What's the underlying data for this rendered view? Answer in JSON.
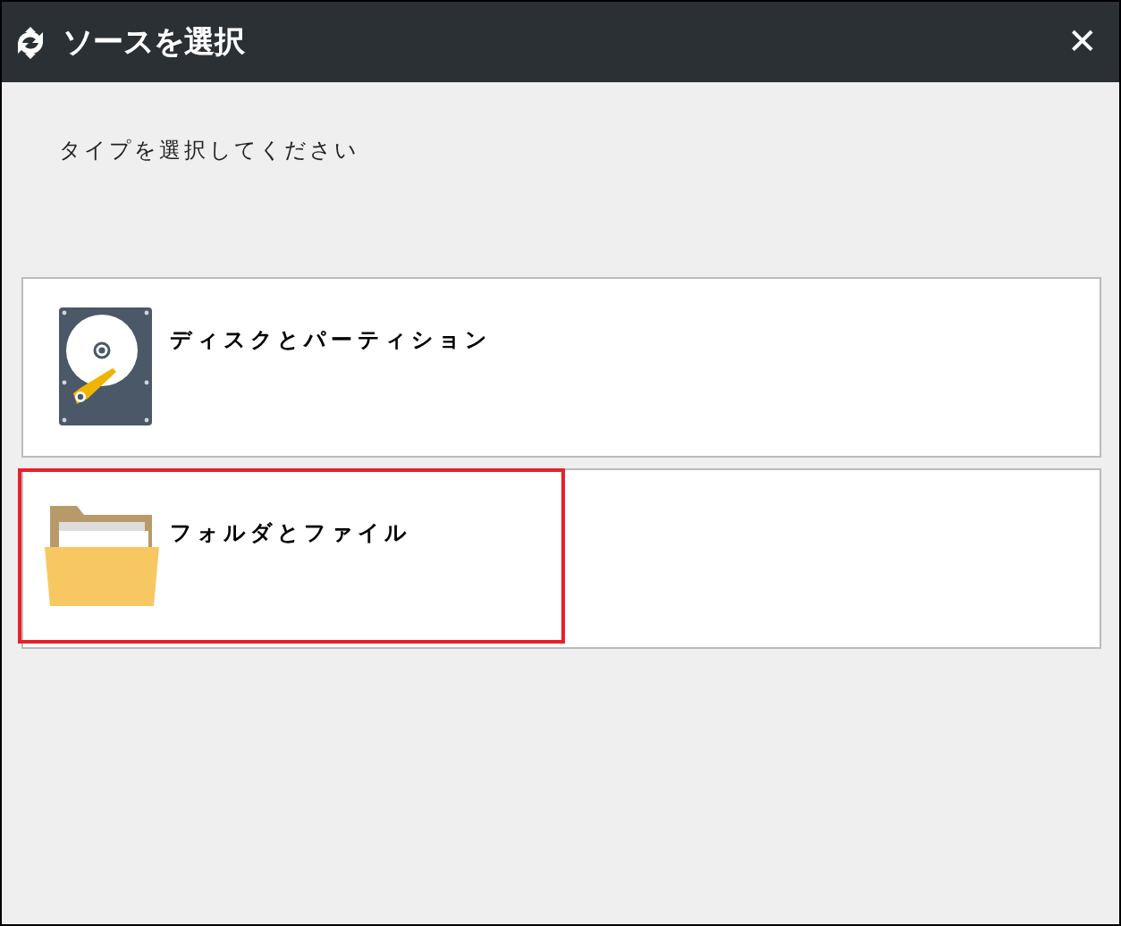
{
  "window": {
    "title": "ソースを選択",
    "close": "✕"
  },
  "prompt": "タイプを選択してください",
  "options": [
    {
      "kind": "disk",
      "label": "ディスクとパーティション",
      "highlighted": false
    },
    {
      "kind": "folder",
      "label": "フォルダとファイル",
      "highlighted": true
    }
  ]
}
